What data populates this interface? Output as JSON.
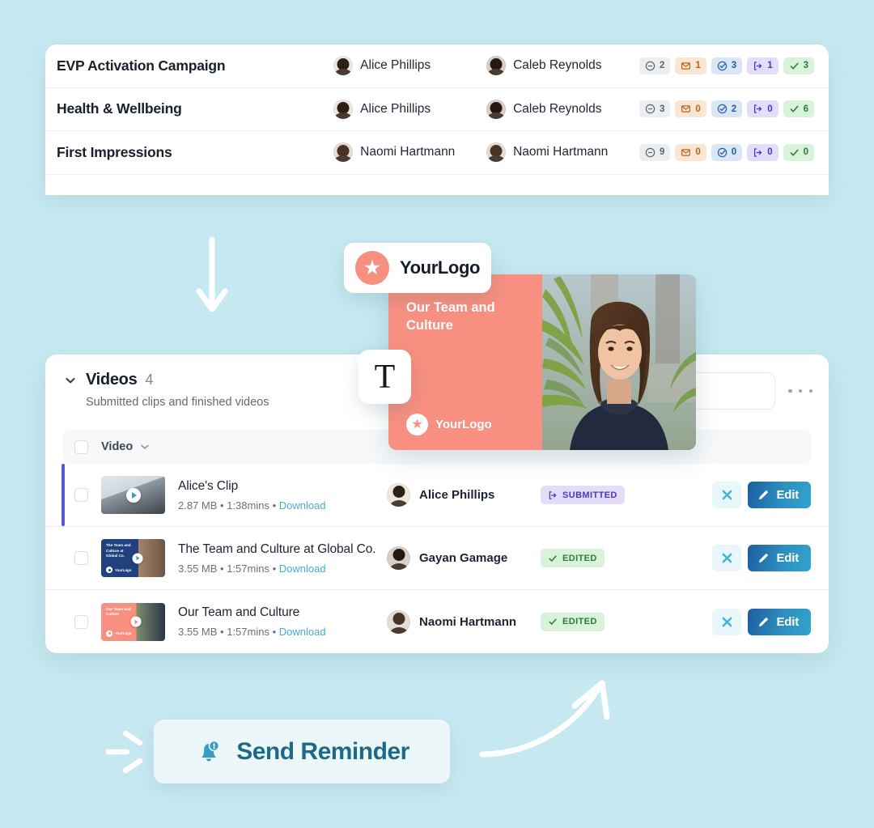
{
  "theme": {
    "background": "#c6e9f1",
    "accent_blue": "#2d8fbf",
    "accent_coral": "#f79080",
    "accent_indigo": "#5a57d6"
  },
  "campaign_table": {
    "rows": [
      {
        "name": "EVP Activation Campaign",
        "owner": "Alice Phillips",
        "manager": "Caleb Reynolds",
        "badges": [
          {
            "icon": "minus-circle-icon",
            "count": "2",
            "style": "gray"
          },
          {
            "icon": "envelope-icon",
            "count": "1",
            "style": "orange"
          },
          {
            "icon": "check-circle-icon",
            "count": "3",
            "style": "blue"
          },
          {
            "icon": "submitted-icon",
            "count": "1",
            "style": "purple"
          },
          {
            "icon": "check-icon",
            "count": "3",
            "style": "green"
          }
        ]
      },
      {
        "name": "Health & Wellbeing",
        "owner": "Alice Phillips",
        "manager": "Caleb Reynolds",
        "badges": [
          {
            "icon": "minus-circle-icon",
            "count": "3",
            "style": "gray"
          },
          {
            "icon": "envelope-icon",
            "count": "0",
            "style": "orange"
          },
          {
            "icon": "check-circle-icon",
            "count": "2",
            "style": "blue"
          },
          {
            "icon": "submitted-icon",
            "count": "0",
            "style": "purple"
          },
          {
            "icon": "check-icon",
            "count": "6",
            "style": "green"
          }
        ]
      },
      {
        "name": "First Impressions",
        "owner": "Naomi Hartmann",
        "manager": "Naomi Hartmann",
        "badges": [
          {
            "icon": "minus-circle-icon",
            "count": "9",
            "style": "gray"
          },
          {
            "icon": "envelope-icon",
            "count": "0",
            "style": "orange"
          },
          {
            "icon": "check-circle-icon",
            "count": "0",
            "style": "blue"
          },
          {
            "icon": "submitted-icon",
            "count": "0",
            "style": "purple"
          },
          {
            "icon": "check-icon",
            "count": "0",
            "style": "green"
          }
        ]
      }
    ]
  },
  "preview": {
    "logo_chip_brand": "YourLogo",
    "text_tool_glyph": "T",
    "card_title": "Our Team and Culture",
    "card_logo_text": "YourLogo",
    "star_glyph": "★"
  },
  "videos_panel": {
    "title": "Videos",
    "count": "4",
    "subtitle": "Submitted clips and finished videos",
    "column_header": "Video",
    "search_value": "",
    "search_placeholder": "",
    "more_label": "⋯",
    "rows": [
      {
        "title": "Alice's Clip",
        "size": "2.87 MB",
        "duration": "1:38mins",
        "download_label": "Download",
        "owner": "Alice Phillips",
        "status": "SUBMITTED",
        "status_style": "submitted",
        "thumb_overlay_title": "",
        "thumb_logo": "",
        "edit_label": "Edit",
        "active": true
      },
      {
        "title": "The Team and Culture at Global Co.",
        "size": "3.55 MB",
        "duration": "1:57mins",
        "download_label": "Download",
        "owner": "Gayan Gamage",
        "status": "EDITED",
        "status_style": "edited",
        "thumb_overlay_title": "The Team and Culture at Global Co.",
        "thumb_logo": "YourLogo",
        "edit_label": "Edit",
        "active": false
      },
      {
        "title": "Our Team and Culture",
        "size": "3.55 MB",
        "duration": "1:57mins",
        "download_label": "Download",
        "owner": "Naomi Hartmann",
        "status": "EDITED",
        "status_style": "edited",
        "thumb_overlay_title": "Our Team and Culture",
        "thumb_logo": "YourLogo",
        "edit_label": "Edit",
        "active": false
      }
    ]
  },
  "reminder": {
    "label": "Send Reminder",
    "icon": "bell-alert-icon"
  }
}
